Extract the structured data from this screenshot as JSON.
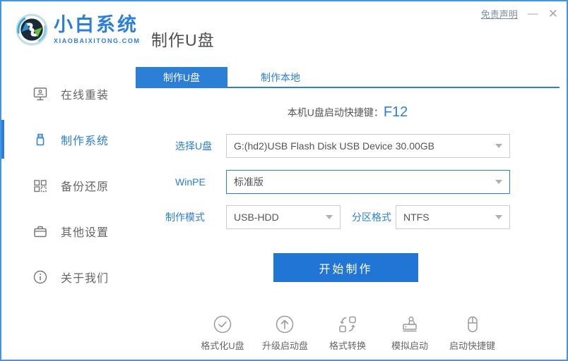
{
  "window": {
    "brand_name": "小白系统",
    "brand_domain": "XIAOBAIXITONG.COM",
    "page_title": "制作U盘",
    "disclaimer_link": "免责声明",
    "minimize_glyph": "—",
    "close_glyph": "✕"
  },
  "sidebar": {
    "items": [
      {
        "label": "在线重装",
        "icon": "monitor-reinstall-icon",
        "active": false
      },
      {
        "label": "制作系统",
        "icon": "usb-drive-icon",
        "active": true
      },
      {
        "label": "备份还原",
        "icon": "backup-restore-icon",
        "active": false
      },
      {
        "label": "其他设置",
        "icon": "briefcase-settings-icon",
        "active": false
      },
      {
        "label": "关于我们",
        "icon": "info-circle-icon",
        "active": false
      }
    ]
  },
  "tabs": [
    {
      "label": "制作U盘",
      "active": true
    },
    {
      "label": "制作本地",
      "active": false
    }
  ],
  "hotkey": {
    "label": "本机U盘启动快捷键：",
    "value": "F12"
  },
  "form": {
    "usb": {
      "label": "选择U盘",
      "value": "G:(hd2)USB Flash Disk USB Device 30.00GB"
    },
    "winpe": {
      "label": "WinPE",
      "value": "标准版"
    },
    "mode": {
      "label": "制作模式",
      "value": "USB-HDD"
    },
    "partition": {
      "label": "分区格式",
      "value": "NTFS"
    }
  },
  "start_button_label": "开始制作",
  "footer_actions": [
    {
      "label": "格式化U盘",
      "icon": "check-circle-icon"
    },
    {
      "label": "升级启动盘",
      "icon": "arrow-up-circle-icon"
    },
    {
      "label": "格式转换",
      "icon": "convert-swap-icon"
    },
    {
      "label": "模拟启动",
      "icon": "stamp-icon"
    },
    {
      "label": "启动快捷键",
      "icon": "mouse-icon"
    }
  ],
  "colors": {
    "primary_blue": "#2b7fd4",
    "button_blue": "#2176d5",
    "window_border_blue": "#4596e2",
    "text_gray": "#555555",
    "icon_gray": "#9a9a9a",
    "logo_green": "#6abf3a"
  }
}
